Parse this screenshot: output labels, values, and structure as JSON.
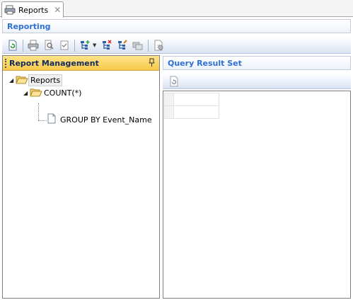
{
  "tab": {
    "label": "Reports",
    "close_glyph": "✕",
    "icon": "reports-tab-icon"
  },
  "header": {
    "title": "Reporting"
  },
  "toolbar": {
    "buttons": [
      {
        "name": "refresh-icon"
      },
      {
        "name": "print-icon"
      },
      {
        "name": "print-preview-icon"
      },
      {
        "name": "report-properties-icon"
      },
      {
        "name": "add-node-icon"
      },
      {
        "name": "delete-node-icon"
      },
      {
        "name": "edit-node-icon"
      },
      {
        "name": "copy-node-icon"
      },
      {
        "name": "export-icon"
      }
    ]
  },
  "left_panel": {
    "title": "Report Management",
    "pin_glyph": "ꟸ",
    "tree": [
      {
        "label": "Reports",
        "level": 0,
        "icon": "folder-open-icon",
        "expanded": true,
        "selected": true
      },
      {
        "label": "COUNT(*)",
        "level": 1,
        "icon": "folder-open-icon",
        "expanded": true
      },
      {
        "label": "GROUP BY Event_Name",
        "level": 2,
        "icon": "document-icon"
      }
    ]
  },
  "right_panel": {
    "title": "Query Result Set",
    "toolbar": [
      {
        "name": "refresh-results-icon"
      }
    ]
  },
  "colors": {
    "accent": "#2d6fd6",
    "panel_header": "#f7c94a",
    "toolbar": "#d9e3f3"
  }
}
